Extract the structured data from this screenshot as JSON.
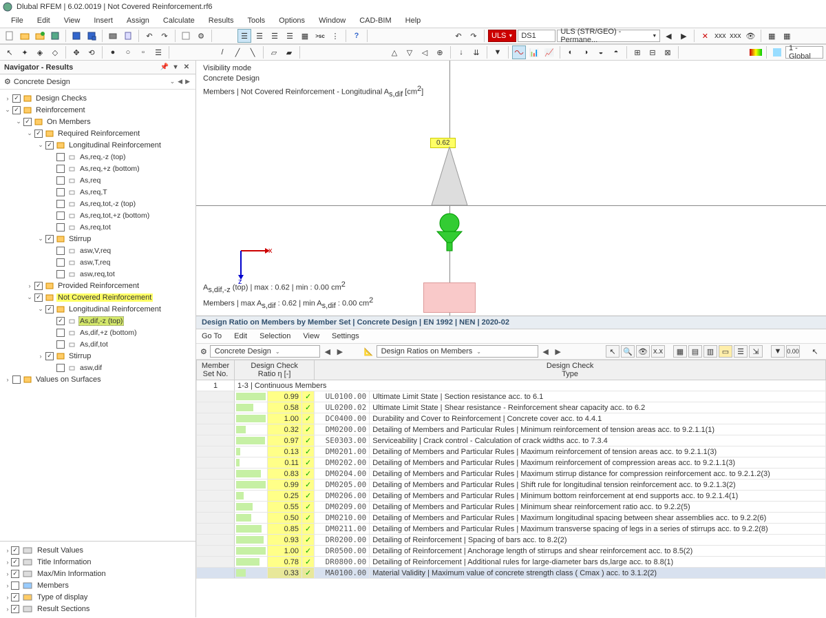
{
  "title": "Dlubal RFEM | 6.02.0019 | Not Covered Reinforcement.rf6",
  "menus": [
    "File",
    "Edit",
    "View",
    "Insert",
    "Assign",
    "Calculate",
    "Results",
    "Tools",
    "Options",
    "Window",
    "CAD-BIM",
    "Help"
  ],
  "toolbar2": {
    "uls_label": "ULS",
    "ds_label": "DS1",
    "combo_long": "ULS (STR/GEO) - Permane...",
    "global": "1 - Global"
  },
  "navigator": {
    "title": "Navigator - Results",
    "subtitle": "Concrete Design",
    "tree": [
      {
        "d": 0,
        "exp": ">",
        "chk": false,
        "on": true,
        "lbl": "Design Checks"
      },
      {
        "d": 0,
        "exp": "v",
        "chk": true,
        "on": true,
        "lbl": "Reinforcement"
      },
      {
        "d": 1,
        "exp": "v",
        "chk": true,
        "on": true,
        "lbl": "On Members"
      },
      {
        "d": 2,
        "exp": "v",
        "chk": true,
        "on": true,
        "lbl": "Required Reinforcement"
      },
      {
        "d": 3,
        "exp": "v",
        "chk": true,
        "on": true,
        "lbl": "Longitudinal Reinforcement"
      },
      {
        "d": 4,
        "exp": "",
        "chk": true,
        "on": false,
        "lbl": "As,req,-z (top)",
        "sub": true
      },
      {
        "d": 4,
        "exp": "",
        "chk": true,
        "on": false,
        "lbl": "As,req,+z (bottom)",
        "sub": true
      },
      {
        "d": 4,
        "exp": "",
        "chk": true,
        "on": false,
        "lbl": "As,req",
        "sub": true
      },
      {
        "d": 4,
        "exp": "",
        "chk": true,
        "on": false,
        "lbl": "As,req,T",
        "sub": true
      },
      {
        "d": 4,
        "exp": "",
        "chk": true,
        "on": false,
        "lbl": "As,req,tot,-z (top)",
        "sub": true
      },
      {
        "d": 4,
        "exp": "",
        "chk": true,
        "on": false,
        "lbl": "As,req,tot,+z (bottom)",
        "sub": true
      },
      {
        "d": 4,
        "exp": "",
        "chk": true,
        "on": false,
        "lbl": "As,req,tot",
        "sub": true
      },
      {
        "d": 3,
        "exp": "v",
        "chk": true,
        "on": true,
        "lbl": "Stirrup"
      },
      {
        "d": 4,
        "exp": "",
        "chk": true,
        "on": false,
        "lbl": "asw,V,req",
        "sub": true
      },
      {
        "d": 4,
        "exp": "",
        "chk": true,
        "on": false,
        "lbl": "asw,T,req",
        "sub": true
      },
      {
        "d": 4,
        "exp": "",
        "chk": true,
        "on": false,
        "lbl": "asw,req,tot",
        "sub": true
      },
      {
        "d": 2,
        "exp": ">",
        "chk": true,
        "on": true,
        "lbl": "Provided Reinforcement"
      },
      {
        "d": 2,
        "exp": "v",
        "chk": true,
        "on": true,
        "lbl": "Not Covered Reinforcement",
        "hl": "yellow"
      },
      {
        "d": 3,
        "exp": "v",
        "chk": true,
        "on": true,
        "lbl": "Longitudinal Reinforcement"
      },
      {
        "d": 4,
        "exp": "",
        "chk": true,
        "on": true,
        "lbl": "As,dif,-z (top)",
        "sub": true,
        "hl": "sel"
      },
      {
        "d": 4,
        "exp": "",
        "chk": true,
        "on": false,
        "lbl": "As,dif,+z (bottom)",
        "sub": true
      },
      {
        "d": 4,
        "exp": "",
        "chk": true,
        "on": false,
        "lbl": "As,dif,tot",
        "sub": true
      },
      {
        "d": 3,
        "exp": ">",
        "chk": true,
        "on": true,
        "lbl": "Stirrup"
      },
      {
        "d": 4,
        "exp": "",
        "chk": true,
        "on": false,
        "lbl": "asw,dif",
        "sub": true
      },
      {
        "d": 0,
        "exp": ">",
        "chk": true,
        "on": false,
        "lbl": "Values on Surfaces"
      }
    ],
    "bottom": [
      {
        "on": true,
        "lbl": "Result Values",
        "color": "#333"
      },
      {
        "on": true,
        "lbl": "Title Information",
        "color": "#333"
      },
      {
        "on": true,
        "lbl": "Max/Min Information",
        "color": "#333"
      },
      {
        "on": false,
        "lbl": "Members",
        "color": "#05a"
      },
      {
        "on": true,
        "lbl": "Type of display",
        "color": "#05a"
      },
      {
        "on": true,
        "lbl": "Result Sections",
        "color": "#333"
      }
    ]
  },
  "viewport": {
    "l1": "Visibility mode",
    "l2": "Concrete Design",
    "l3_a": "Members | Not Covered Reinforcement - Longitudinal A",
    "l3_b": " [cm",
    "l3_c": "]",
    "tag": "0.62",
    "axis_x": "x",
    "axis_z": "z",
    "s1_a": "A",
    "s1_b": " (top) | max  : 0.62 | min  : 0.00 cm",
    "s2_a": "Members | max A",
    "s2_b": " : 0.62 | min A",
    "s2_c": " : 0.00 cm"
  },
  "results": {
    "title": "Design Ratio on Members by Member Set | Concrete Design | EN 1992 | NEN | 2020-02",
    "menus": [
      "Go To",
      "Edit",
      "Selection",
      "View",
      "Settings"
    ],
    "combo1": "Concrete Design",
    "combo2": "Design Ratios on Members",
    "headers": {
      "c1": "Member\nSet No.",
      "c2": "Design Check\nRatio η [-]",
      "c3": "Design Check\nType"
    },
    "group": {
      "no": "1",
      "lbl": "1-3 | Continuous Members"
    },
    "rows": [
      {
        "ratio": "0.99",
        "code": "UL0100.00",
        "desc": "Ultimate Limit State | Section resistance acc. to 6.1",
        "bar": 99
      },
      {
        "ratio": "0.58",
        "code": "UL0200.02",
        "desc": "Ultimate Limit State | Shear resistance - Reinforcement shear capacity acc. to 6.2",
        "bar": 58
      },
      {
        "ratio": "1.00",
        "code": "DC0400.00",
        "desc": "Durability and Cover to Reinforcement | Concrete cover acc. to 4.4.1",
        "bar": 100
      },
      {
        "ratio": "0.32",
        "code": "DM0200.00",
        "desc": "Detailing of Members and Particular Rules | Minimum reinforcement of tension areas acc. to 9.2.1.1(1)",
        "bar": 32
      },
      {
        "ratio": "0.97",
        "code": "SE0303.00",
        "desc": "Serviceability | Crack control - Calculation of crack widths acc. to 7.3.4",
        "bar": 97
      },
      {
        "ratio": "0.13",
        "code": "DM0201.00",
        "desc": "Detailing of Members and Particular Rules | Maximum reinforcement of tension areas acc. to 9.2.1.1(3)",
        "bar": 13
      },
      {
        "ratio": "0.11",
        "code": "DM0202.00",
        "desc": "Detailing of Members and Particular Rules | Maximum reinforcement of compression areas acc. to 9.2.1.1(3)",
        "bar": 11
      },
      {
        "ratio": "0.83",
        "code": "DM0204.00",
        "desc": "Detailing of Members and Particular Rules | Maximum stirrup distance for compression reinforcement acc. to 9.2.1.2(3)",
        "bar": 83
      },
      {
        "ratio": "0.99",
        "code": "DM0205.00",
        "desc": "Detailing of Members and Particular Rules | Shift rule for longitudinal tension reinforcement acc. to 9.2.1.3(2)",
        "bar": 99
      },
      {
        "ratio": "0.25",
        "code": "DM0206.00",
        "desc": "Detailing of Members and Particular Rules | Minimum bottom reinforcement at end supports acc. to 9.2.1.4(1)",
        "bar": 25
      },
      {
        "ratio": "0.55",
        "code": "DM0209.00",
        "desc": "Detailing of Members and Particular Rules | Minimum shear reinforcement ratio acc. to 9.2.2(5)",
        "bar": 55
      },
      {
        "ratio": "0.50",
        "code": "DM0210.00",
        "desc": "Detailing of Members and Particular Rules | Maximum longitudinal spacing between shear assemblies acc. to 9.2.2(6)",
        "bar": 50
      },
      {
        "ratio": "0.85",
        "code": "DM0211.00",
        "desc": "Detailing of Members and Particular Rules | Maximum transverse spacing of legs in a series of stirrups acc. to 9.2.2(8)",
        "bar": 85
      },
      {
        "ratio": "0.93",
        "code": "DR0200.00",
        "desc": "Detailing of Reinforcement | Spacing of bars acc. to 8.2(2)",
        "bar": 93
      },
      {
        "ratio": "1.00",
        "code": "DR0500.00",
        "desc": "Detailing of Reinforcement | Anchorage length of stirrups and shear reinforcement acc. to 8.5(2)",
        "bar": 100
      },
      {
        "ratio": "0.78",
        "code": "DR0800.00",
        "desc": "Detailing of Reinforcement | Additional rules for large-diameter bars ds,large acc. to 8.8(1)",
        "bar": 78
      },
      {
        "ratio": "0.33",
        "code": "MA0100.00",
        "desc": "Material Validity | Maximum value of concrete strength class ( Cmax ) acc. to 3.1.2(2)",
        "bar": 33,
        "sel": true
      }
    ]
  }
}
